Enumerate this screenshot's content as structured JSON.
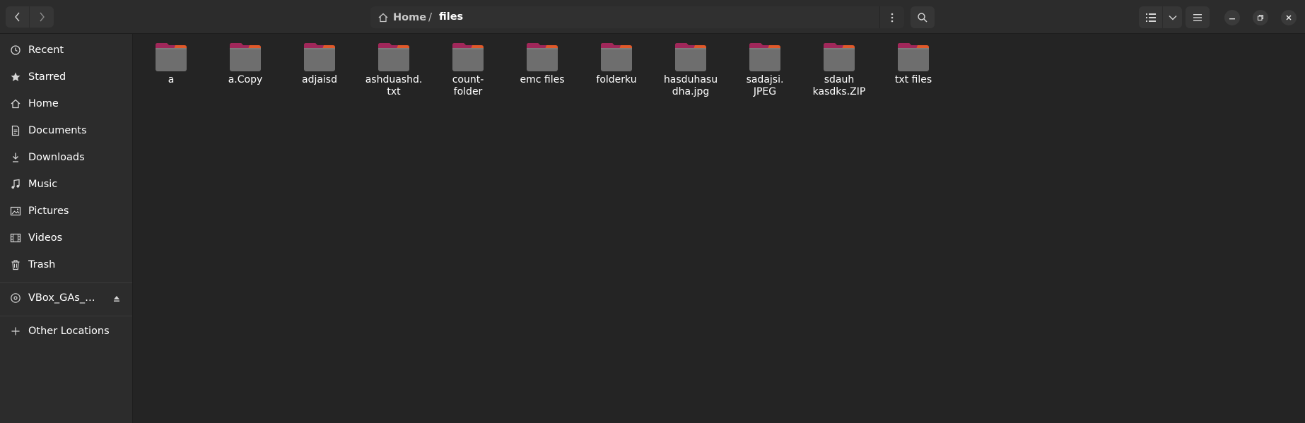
{
  "header": {
    "path": {
      "home_label": "Home",
      "separator": "/",
      "current_label": "files"
    }
  },
  "sidebar": {
    "items": [
      {
        "label": "Recent",
        "icon": "clock-icon"
      },
      {
        "label": "Starred",
        "icon": "star-icon"
      },
      {
        "label": "Home",
        "icon": "home-icon"
      },
      {
        "label": "Documents",
        "icon": "document-icon"
      },
      {
        "label": "Downloads",
        "icon": "download-icon"
      },
      {
        "label": "Music",
        "icon": "music-icon"
      },
      {
        "label": "Pictures",
        "icon": "picture-icon"
      },
      {
        "label": "Videos",
        "icon": "video-icon"
      },
      {
        "label": "Trash",
        "icon": "trash-icon"
      }
    ],
    "device": {
      "label": "VBox_GAs_7....",
      "icon": "disc-icon",
      "action_icon": "eject-icon"
    },
    "other": {
      "label": "Other Locations",
      "icon": "plus-icon"
    }
  },
  "files": [
    {
      "name": "a"
    },
    {
      "name": "a.Copy"
    },
    {
      "name": "adjaisd"
    },
    {
      "name": "ashduashd.\ntxt"
    },
    {
      "name": "count-\nfolder"
    },
    {
      "name": "emc files"
    },
    {
      "name": "folderku"
    },
    {
      "name": "hasduhasu\ndha.jpg"
    },
    {
      "name": "sadajsi.\nJPEG"
    },
    {
      "name": "sdauh\nkasdks.ZIP"
    },
    {
      "name": "txt files"
    }
  ],
  "colors": {
    "background": "#242424",
    "sidebar": "#2c2c2c",
    "folder_body": "#6e6e6e",
    "folder_tab_magenta": "#a0275a",
    "folder_tab_orange": "#e0592a"
  }
}
